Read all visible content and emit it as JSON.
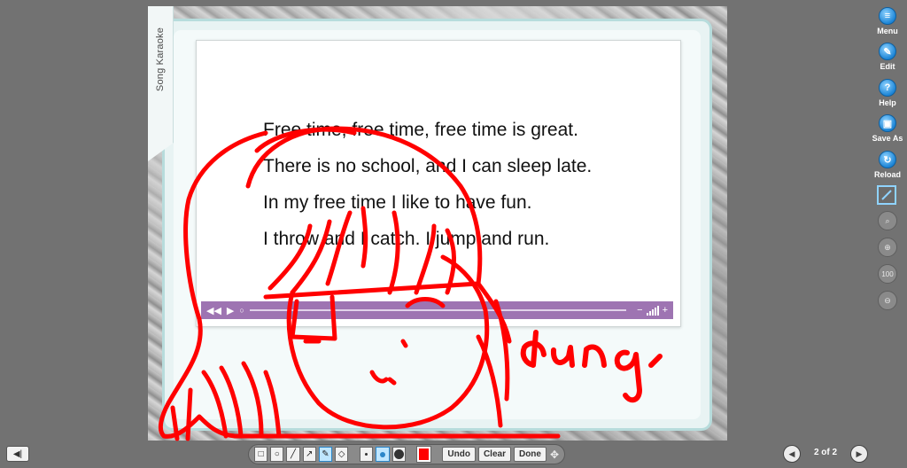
{
  "book": {
    "tab_label": "Song Karaoke",
    "lyrics": [
      "Free time, free time, free time is great.",
      "There is no school, and I can sleep late.",
      "In my free time I like to have fun.",
      "I throw and I catch. I jump and run."
    ],
    "annotation_text": "dung",
    "pen_color": "#ff0000"
  },
  "player": {
    "rewind_icon": "rewind-icon",
    "play_icon": "play-icon",
    "volume_minus": "−",
    "volume_plus": "+"
  },
  "sidebar": {
    "items": [
      {
        "label": "Menu",
        "icon": "menu-icon",
        "glyph": "≡"
      },
      {
        "label": "Edit",
        "icon": "edit-icon",
        "glyph": "✎"
      },
      {
        "label": "Help",
        "icon": "help-icon",
        "glyph": "?"
      },
      {
        "label": "Save As",
        "icon": "save-icon",
        "glyph": "▣"
      },
      {
        "label": "Reload",
        "icon": "reload-icon",
        "glyph": "↻"
      }
    ],
    "zoom_level": "100"
  },
  "toolbar": {
    "undo_label": "Undo",
    "clear_label": "Clear",
    "done_label": "Done",
    "selected_color": "#ff0000"
  },
  "pager": {
    "page_indicator": "2 of 2"
  }
}
